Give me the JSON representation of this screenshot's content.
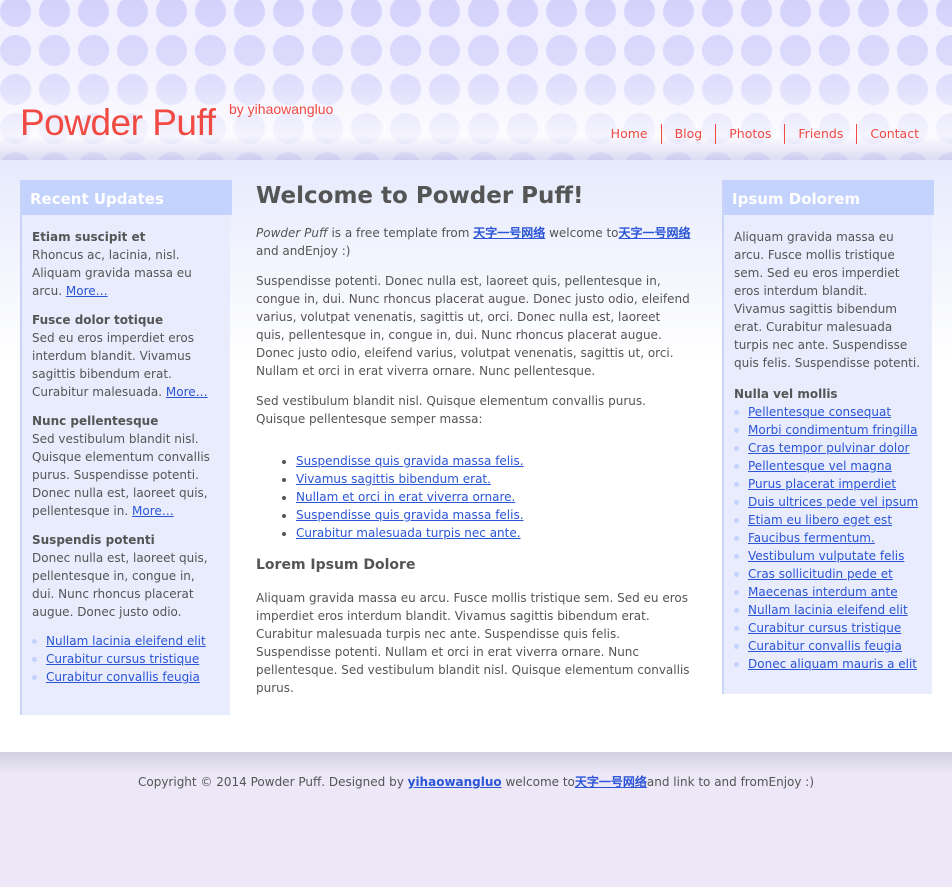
{
  "site": {
    "title": "Powder Puff",
    "byline": "by yihaowangluo",
    "accent_color": "#f04a42",
    "link_color": "#2b55d6",
    "sidebar_header_color": "#c4d2fe"
  },
  "nav": [
    {
      "label": "Home"
    },
    {
      "label": "Blog"
    },
    {
      "label": "Photos"
    },
    {
      "label": "Friends"
    },
    {
      "label": "Contact"
    }
  ],
  "left_sidebar": {
    "heading": "Recent Updates",
    "updates": [
      {
        "title": "Etiam suscipit et",
        "text": "Rhoncus ac, lacinia, nisl. Aliquam gravida massa eu arcu.",
        "more": "More…"
      },
      {
        "title": "Fusce dolor totique",
        "text": "Sed eu eros imperdiet eros interdum blandit. Vivamus sagittis bibendum erat. Curabitur malesuada.",
        "more": "More…"
      },
      {
        "title": "Nunc pellentesque",
        "text": "Sed vestibulum blandit nisl. Quisque elementum convallis purus. Suspendisse potenti. Donec nulla est, laoreet quis, pellentesque in.",
        "more": "More…"
      },
      {
        "title": "Suspendis potenti",
        "text": "Donec nulla est, laoreet quis, pellentesque in, congue in, dui. Nunc rhoncus placerat augue. Donec justo odio."
      }
    ],
    "links": [
      "Nullam lacinia eleifend elit",
      "Curabitur cursus tristique",
      "Curabitur convallis feugia"
    ]
  },
  "main": {
    "heading": "Welcome to Powder Puff!",
    "intro": {
      "name": "Powder Puff",
      "text1": " is a free template from ",
      "link1": "天字一号网络",
      "text2": " welcome to",
      "link2": "天字一号网络",
      "text3": "and andEnjoy :)"
    },
    "paragraph1": "Suspendisse potenti. Donec nulla est, laoreet quis, pellentesque in, congue in, dui. Nunc rhoncus placerat augue. Donec justo odio, eleifend varius, volutpat venenatis, sagittis ut, orci. Donec nulla est, laoreet quis, pellentesque in, congue in, dui. Nunc rhoncus placerat augue. Donec justo odio, eleifend varius, volutpat venenatis, sagittis ut, orci. Nullam et orci in erat viverra ornare. Nunc pellentesque.",
    "paragraph2": "Sed vestibulum blandit nisl. Quisque elementum convallis purus. Quisque pellentesque semper massa:",
    "list": [
      "Suspendisse quis gravida massa felis.",
      "Vivamus sagittis bibendum erat.",
      "Nullam et orci in erat viverra ornare.",
      "Suspendisse quis gravida massa felis.",
      "Curabitur malesuada turpis nec ante."
    ],
    "subheading": "Lorem Ipsum Dolore",
    "paragraph3": "Aliquam gravida massa eu arcu. Fusce mollis tristique sem. Sed eu eros imperdiet eros interdum blandit. Vivamus sagittis bibendum erat. Curabitur malesuada turpis nec ante. Suspendisse quis felis. Suspendisse potenti. Nullam et orci in erat viverra ornare. Nunc pellentesque. Sed vestibulum blandit nisl. Quisque elementum convallis purus."
  },
  "right_sidebar": {
    "heading": "Ipsum Dolorem",
    "text": "Aliquam gravida massa eu arcu. Fusce mollis tristique sem. Sed eu eros imperdiet eros interdum blandit. Vivamus sagittis bibendum erat. Curabitur malesuada turpis nec ante. Suspendisse quis felis. Suspendisse potenti.",
    "subheading": "Nulla vel mollis",
    "links": [
      "Pellentesque consequat",
      "Morbi condimentum fringilla",
      "Cras tempor pulvinar dolor",
      "Pellentesque vel magna",
      "Purus placerat imperdiet",
      "Duis ultrices pede vel ipsum",
      "Etiam eu libero eget est",
      "Faucibus fermentum.",
      "Vestibulum vulputate felis",
      "Cras sollicitudin pede et",
      "Maecenas interdum ante",
      "Nullam lacinia eleifend elit",
      "Curabitur cursus tristique",
      "Curabitur convallis feugia",
      "Donec aliquam mauris a elit"
    ]
  },
  "footer": {
    "text1": "Copyright © 2014 Powder Puff. Designed by ",
    "author_link": "yihaowangluo",
    "text2": " welcome to",
    "site_link": "天字一号网络",
    "text3": "and link to and fromEnjoy :)"
  }
}
